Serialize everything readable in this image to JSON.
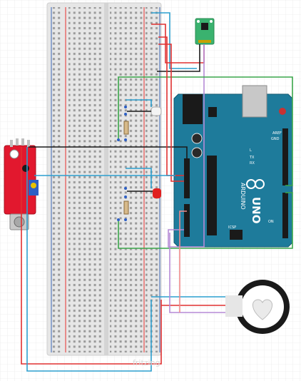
{
  "arduino": {
    "logo_text": "UNO",
    "brand_text": "ARDUINO",
    "icsp_label": "ICSP",
    "tx_label": "TX",
    "rx_label": "RX",
    "l_label": "L",
    "on_label": "ON",
    "aref_label": "AREF",
    "gnd_label": "GND"
  },
  "watermark": {
    "text": "fritzing"
  },
  "colors": {
    "board": "#1e7b9b",
    "breadboard": "#e6e6e6",
    "rail_red": "#e8302f",
    "rail_blue": "#3a66b5",
    "wire_red": "#e03030",
    "wire_blue": "#2c9fcf",
    "wire_green": "#3aa64a",
    "wire_purple": "#b58ad6",
    "wire_black": "#1a1a1a",
    "wire_pink": "#f08a8a",
    "sensor_module": "#e2182e",
    "accel_module": "#3ab26f"
  }
}
